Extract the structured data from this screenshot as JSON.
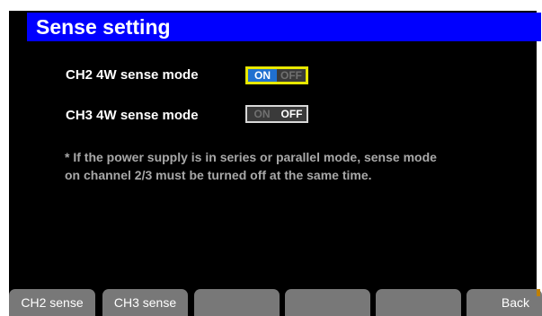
{
  "title": "Sense setting",
  "settings": [
    {
      "label": "CH2 4W sense mode",
      "on_label": "ON",
      "off_label": "OFF",
      "state": "ON",
      "focused": true
    },
    {
      "label": "CH3 4W sense mode",
      "on_label": "ON",
      "off_label": "OFF",
      "state": "OFF",
      "focused": false
    }
  ],
  "note_line1": "* If the power supply is in series or parallel mode, sense mode",
  "note_line2": "on channel 2/3 must be turned off at the same time.",
  "softkeys": [
    "CH2 sense",
    "CH3 sense",
    "",
    "",
    "",
    "Back"
  ],
  "colors": {
    "title_bar": "#0000ff",
    "on_active": "#2070d0",
    "focus_border": "#e8e800",
    "softkey": "#787878"
  }
}
